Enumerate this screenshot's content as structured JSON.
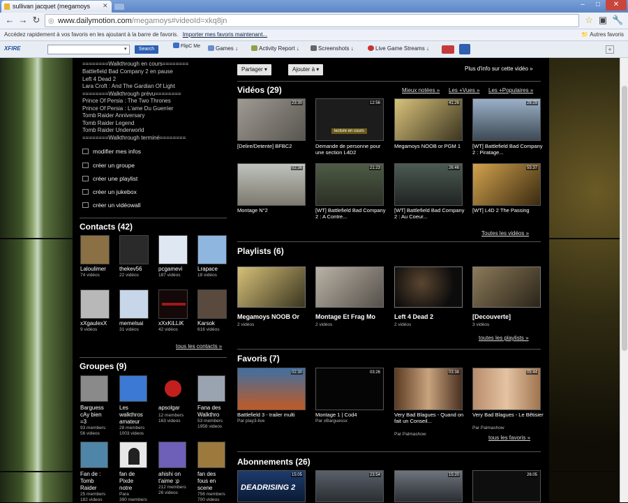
{
  "browser": {
    "tab_title": "sullivan jacquet (megamoys",
    "url_host": "www.dailymotion.com",
    "url_path": "/megamoys#videoId=xkq8jn",
    "bookmark_hint": "Accédez rapidement à vos favoris en les ajoutant à la barre de favoris.",
    "bookmark_import": "Importer mes favoris maintenant...",
    "other_bookmarks": "Autres favoris"
  },
  "toolbar": {
    "logo": "XFIRE",
    "search_btn": "Search",
    "items": [
      "FlipC Me",
      "Games",
      "Activity Report",
      "Screenshots",
      "Live Game Streams"
    ]
  },
  "walkthrough": {
    "lines": [
      "========Walkthrough en cours========",
      "Battlefield Bad Company 2 en pause",
      "Left 4 Dead 2",
      "Lara Croft : And The Gardian Of Light",
      "========Walkthrough prévu========",
      "Prince Of Persia : The Two Thrones",
      "Prince Of Persia : L'ame Du Guerrier",
      "Tomb Raider Anniversary",
      "Tomb Raider Legend",
      "Tomb Raider Underworld",
      "========Walkthrough terminé========"
    ]
  },
  "actions": [
    "modifier mes infos",
    "créer un groupe",
    "créer une playlist",
    "créer un jukebox",
    "créer un vidéowall"
  ],
  "contacts": {
    "title": "Contacts (42)",
    "more": "tous les contacts »",
    "items": [
      {
        "name": "Laloulimer",
        "count": "74 vidéos"
      },
      {
        "name": "thekev56",
        "count": "22 vidéos"
      },
      {
        "name": "pcgamevi",
        "count": "187 vidéos"
      },
      {
        "name": "Lrapace",
        "count": "18 vidéos"
      },
      {
        "name": "xXgaulexX",
        "count": "9 vidéos"
      },
      {
        "name": "memelsai",
        "count": "31 vidéos"
      },
      {
        "name": "xXxKiLLiK",
        "count": "42 vidéos"
      },
      {
        "name": "Karsok",
        "count": "616 vidéos"
      }
    ]
  },
  "groups": {
    "title": "Groupes (9)",
    "items": [
      {
        "lines": [
          "Barguess",
          "cAy bien",
          "=3"
        ],
        "sub": [
          "93 members",
          "56 videos"
        ]
      },
      {
        "lines": [
          "Les",
          "walkthros",
          "amateur"
        ],
        "sub": [
          "28 members",
          "1003 videos"
        ]
      },
      {
        "lines": [
          "apsolgar",
          ""
        ],
        "sub": [
          "12 members",
          "163 videos"
        ]
      },
      {
        "lines": [
          "Fana des",
          "Walkthro"
        ],
        "sub": [
          "53 members",
          "1958 videos"
        ]
      },
      {
        "lines": [
          "Fan de :",
          "Tomb",
          "Raider"
        ],
        "sub": [
          "25 members",
          "182 videos"
        ]
      },
      {
        "lines": [
          "fan de",
          "Pixde",
          "notre"
        ],
        "sub": [
          "Para",
          "390 members"
        ]
      },
      {
        "lines": [
          "ahishi on",
          "t'aime :p"
        ],
        "sub": [
          "212 members",
          "26 videos"
        ]
      },
      {
        "lines": [
          "fan des",
          "fous en",
          "scene"
        ],
        "sub": [
          "756 members",
          "700 videos"
        ]
      }
    ]
  },
  "header_buttons": {
    "share": "Partager",
    "add": "Ajouter à",
    "more_info": "Plus d'info sur cette vidéo »"
  },
  "videos": {
    "title": "Vidéos (29)",
    "sorts": [
      "Mieux notées »",
      "Les +Vues »",
      "Les +Populaires »"
    ],
    "more": "Toutes les vidéos »",
    "items": [
      {
        "title": "[Delire/Detente] BFBC2",
        "dur": "23:30"
      },
      {
        "title": "Demande de personne pour une section L4D2",
        "dur": "12:56",
        "overlay": "lecture en cours"
      },
      {
        "title": "Megamoys NOOB or PGM 1",
        "dur": "41:26"
      },
      {
        "title": "[WT] Battlefield Bad Company 2 : Piratage...",
        "dur": "28:29"
      },
      {
        "title": "Montage N°2",
        "dur": "02:36"
      },
      {
        "title": "[WT] Battlefield Bad Company 2 : A Contre...",
        "dur": "21:23"
      },
      {
        "title": "[WT] Battlefield Bad Company 2 : Au Coeur...",
        "dur": "26:46"
      },
      {
        "title": "[WT] L4D 2 The Passing",
        "dur": "55:37"
      }
    ]
  },
  "playlists": {
    "title": "Playlists (6)",
    "more": "toutes les playlists »",
    "items": [
      {
        "title": "Megamoys NOOB Or",
        "count": "2 vidéos"
      },
      {
        "title": "Montage Et Frag Mo",
        "count": "2 vidéos"
      },
      {
        "title": "Left 4 Dead 2",
        "count": "2 vidéos"
      },
      {
        "title": "[Decouverte]",
        "count": "3 vidéos"
      }
    ]
  },
  "favorites": {
    "title": "Favoris (7)",
    "more": "tous les favoris »",
    "items": [
      {
        "title": "Battlefield 3 - trailer multi",
        "by": "Par play3-live",
        "dur": "02:30"
      },
      {
        "title": "Montage 1 | Cod4",
        "by": "Par xBarguessx",
        "dur": "03:26"
      },
      {
        "title": "Very Bad Blagues - Quand on fait un Conseil...",
        "by": "Par Palmashow",
        "dur": "03:38"
      },
      {
        "title": "Very Bad Blagues - Le Bêtisier",
        "by": "Par Palmashow",
        "dur": "05:44"
      }
    ]
  },
  "subscriptions": {
    "title": "Abonnements (26)",
    "items": [
      {
        "dur": "15:05"
      },
      {
        "dur": "23:54"
      },
      {
        "dur": "15:20"
      },
      {
        "dur": "26:05"
      }
    ]
  }
}
